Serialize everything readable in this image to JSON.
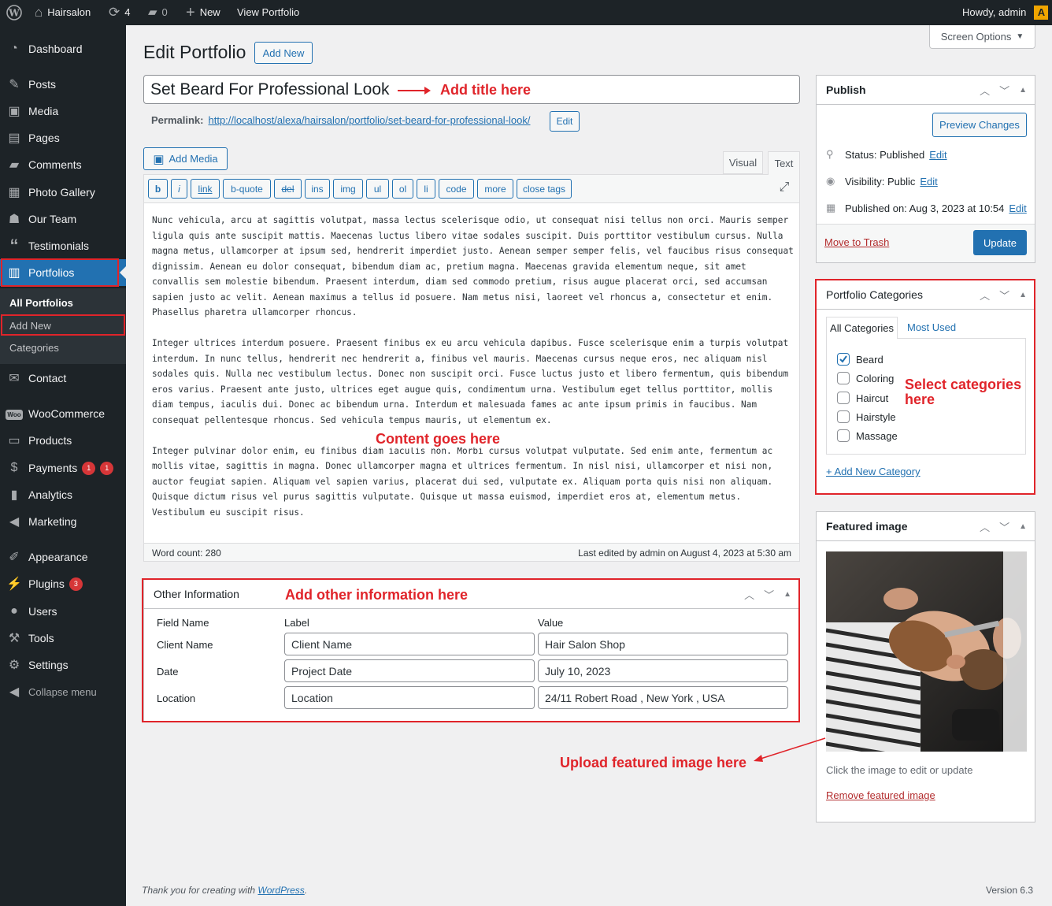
{
  "adminbar": {
    "site_name": "Hairsalon",
    "updates_count": "4",
    "comments_count": "0",
    "new_label": "New",
    "view_label": "View Portfolio",
    "howdy": "Howdy, admin"
  },
  "sidebar": {
    "items": [
      {
        "label": "Dashboard",
        "icon": "dashboard-icon"
      },
      {
        "label": "Posts",
        "icon": "pin-icon"
      },
      {
        "label": "Media",
        "icon": "media-icon"
      },
      {
        "label": "Pages",
        "icon": "pages-icon"
      },
      {
        "label": "Comments",
        "icon": "comments-icon"
      },
      {
        "label": "Photo Gallery",
        "icon": "gallery-icon"
      },
      {
        "label": "Our Team",
        "icon": "team-icon"
      },
      {
        "label": "Testimonials",
        "icon": "quote-icon"
      },
      {
        "label": "Portfolios",
        "icon": "portfolio-icon"
      },
      {
        "label": "Contact",
        "icon": "mail-icon"
      },
      {
        "label": "WooCommerce",
        "icon": "woo-icon"
      },
      {
        "label": "Products",
        "icon": "archive-icon"
      },
      {
        "label": "Payments",
        "icon": "dollar-icon",
        "badges": [
          "1",
          "1"
        ]
      },
      {
        "label": "Analytics",
        "icon": "chart-icon"
      },
      {
        "label": "Marketing",
        "icon": "megaphone-icon"
      },
      {
        "label": "Appearance",
        "icon": "brush-icon"
      },
      {
        "label": "Plugins",
        "icon": "plugin-icon",
        "badges": [
          "3"
        ]
      },
      {
        "label": "Users",
        "icon": "user-icon"
      },
      {
        "label": "Tools",
        "icon": "wrench-icon"
      },
      {
        "label": "Settings",
        "icon": "settings-icon"
      },
      {
        "label": "Collapse menu",
        "icon": "collapse-icon"
      }
    ],
    "submenu": [
      "All Portfolios",
      "Add New",
      "Categories"
    ]
  },
  "header": {
    "screen_options": "Screen Options",
    "title": "Edit Portfolio",
    "add_new": "Add New"
  },
  "post": {
    "title": "Set Beard For Professional Look",
    "permalink_label": "Permalink:",
    "permalink_url": "http://localhost/alexa/hairsalon/portfolio/set-beard-for-professional-look/",
    "edit_label": "Edit"
  },
  "editor": {
    "add_media": "Add Media",
    "tab_visual": "Visual",
    "tab_text": "Text",
    "quicktags": [
      "b",
      "i",
      "link",
      "b-quote",
      "del",
      "ins",
      "img",
      "ul",
      "ol",
      "li",
      "code",
      "more",
      "close tags"
    ],
    "paragraphs": [
      "Nunc vehicula, arcu at sagittis volutpat, massa lectus scelerisque odio, ut consequat nisi tellus non orci. Mauris semper ligula quis ante suscipit mattis. Maecenas luctus libero vitae sodales suscipit. Duis porttitor vestibulum cursus. Nulla magna metus, ullamcorper at ipsum sed, hendrerit imperdiet justo. Aenean semper semper felis, vel faucibus risus consequat dignissim. Aenean eu dolor consequat, bibendum diam ac, pretium magna. Maecenas gravida elementum neque, sit amet convallis sem molestie bibendum. Praesent interdum, diam sed commodo pretium, risus augue placerat orci, sed accumsan sapien justo ac velit. Aenean maximus a tellus id posuere. Nam metus nisi, laoreet vel rhoncus a, consectetur et enim. Phasellus pharetra ullamcorper rhoncus.",
      "Integer ultrices interdum posuere. Praesent finibus ex eu arcu vehicula dapibus. Fusce scelerisque enim a turpis volutpat interdum. In nunc tellus, hendrerit nec hendrerit a, finibus vel mauris. Maecenas cursus neque eros, nec aliquam nisl sodales quis. Nulla nec vestibulum lectus. Donec non suscipit orci. Fusce luctus justo et libero fermentum, quis bibendum eros varius. Praesent ante justo, ultrices eget augue quis, condimentum urna. Vestibulum eget tellus porttitor, mollis diam tempus, iaculis dui. Donec ac bibendum urna. Interdum et malesuada fames ac ante ipsum primis in faucibus. Nam consequat pellentesque rhoncus. Sed vehicula tempus mauris, ut elementum ex.",
      "Integer pulvinar dolor enim, eu finibus diam iaculis non. Morbi cursus volutpat vulputate. Sed enim ante, fermentum ac mollis vitae, sagittis in magna. Donec ullamcorper magna et ultrices fermentum. In nisl nisi, ullamcorper et nisi non, auctor feugiat sapien. Aliquam vel sapien varius, placerat dui sed, vulputate ex. Aliquam porta quis nisi non aliquam. Quisque dictum risus vel purus sagittis vulputate. Quisque ut massa euismod, imperdiet eros at, elementum metus. Vestibulum eu suscipit risus."
    ],
    "word_count": "Word count: 280",
    "last_edited": "Last edited by admin on August 4, 2023 at 5:30 am"
  },
  "other_info": {
    "title": "Other Information",
    "col_field": "Field Name",
    "col_label": "Label",
    "col_value": "Value",
    "rows": [
      {
        "field": "Client Name",
        "label": "Client Name",
        "value": "Hair Salon Shop"
      },
      {
        "field": "Date",
        "label": "Project Date",
        "value": "July 10, 2023"
      },
      {
        "field": "Location",
        "label": "Location",
        "value": "24/11 Robert Road , New York , USA"
      }
    ]
  },
  "publish": {
    "title": "Publish",
    "preview": "Preview Changes",
    "status": "Status: Published",
    "visibility": "Visibility: Public",
    "published_on": "Published on: Aug 3, 2023 at 10:54",
    "edit": "Edit",
    "trash": "Move to Trash",
    "update": "Update"
  },
  "categories": {
    "title": "Portfolio Categories",
    "tab_all": "All Categories",
    "tab_most": "Most Used",
    "items": [
      {
        "label": "Beard",
        "checked": true
      },
      {
        "label": "Coloring",
        "checked": false
      },
      {
        "label": "Haircut",
        "checked": false
      },
      {
        "label": "Hairstyle",
        "checked": false
      },
      {
        "label": "Massage",
        "checked": false
      }
    ],
    "add_new": "+ Add New Category"
  },
  "featured": {
    "title": "Featured image",
    "hint": "Click the image to edit or update",
    "remove": "Remove featured image"
  },
  "annotations": {
    "title": "Add title here",
    "content": "Content goes here",
    "other": "Add other information here",
    "categories_line1": "Select categories",
    "categories_line2": "here",
    "featured": "Upload featured image here"
  },
  "footer": {
    "thanks": "Thank you for creating with",
    "wp_link": "WordPress",
    "version": "Version 6.3"
  },
  "colors": {
    "accent": "#2271b1",
    "annotation": "#e0242a",
    "sidebar": "#1d2327"
  }
}
